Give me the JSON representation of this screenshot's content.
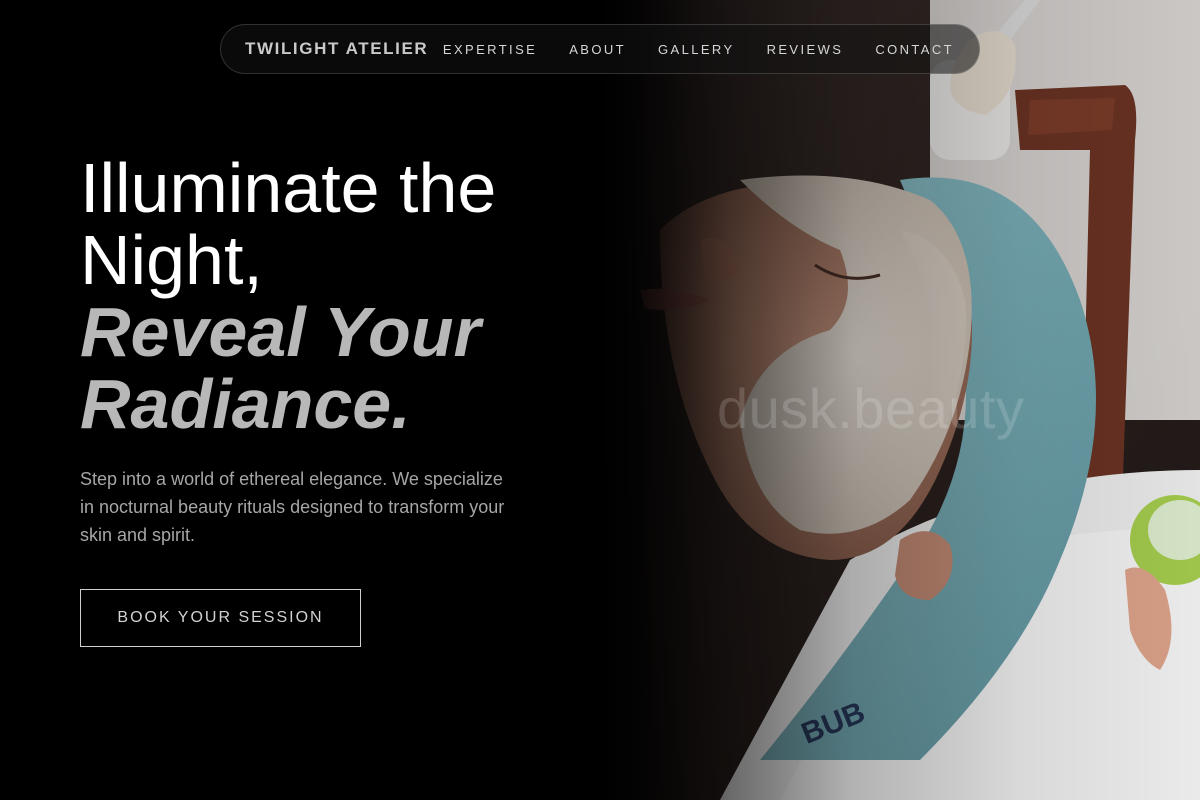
{
  "brand": {
    "name": "TWILIGHT ATELIER"
  },
  "nav": {
    "links": [
      {
        "label": "EXPERTISE"
      },
      {
        "label": "ABOUT"
      },
      {
        "label": "GALLERY"
      },
      {
        "label": "REVIEWS"
      },
      {
        "label": "CONTACT"
      }
    ]
  },
  "hero": {
    "headline_line1": "Illuminate the",
    "headline_line2": "Night,",
    "headline_italic_line1": "Reveal Your",
    "headline_italic_line2": "Radiance.",
    "lead": "Step into a world of ethereal elegance. We specialize in nocturnal beauty rituals designed to transform your skin and spirit.",
    "cta_label": "BOOK YOUR SESSION",
    "image_watermark": "dusk.beauty",
    "headband_text": "BUB"
  },
  "colors": {
    "background": "#000000",
    "text_primary": "#ffffff",
    "text_italic": "#b8b8b8",
    "text_muted": "#a6a6a6",
    "headband": "#7fb4bd",
    "face_mask": "#e6ddd4",
    "skin": "#c7917a",
    "bowl": "#a7cf4f"
  },
  "icons": [
    "brush-icon"
  ]
}
